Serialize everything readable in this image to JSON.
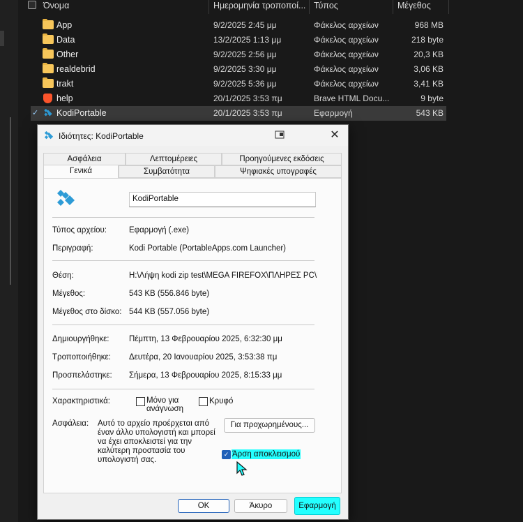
{
  "explorer": {
    "columns": {
      "name": "Όνομα",
      "date": "Ημερομηνία τροποποί...",
      "type": "Τύπος",
      "size": "Μέγεθος"
    },
    "rows": [
      {
        "name": "App",
        "date": "9/2/2025 2:45 μμ",
        "type": "Φάκελος αρχείων",
        "size": "968 MB",
        "icon": "folder-icon"
      },
      {
        "name": "Data",
        "date": "13/2/2025 1:13 μμ",
        "type": "Φάκελος αρχείων",
        "size": "218 byte",
        "icon": "folder-icon"
      },
      {
        "name": "Other",
        "date": "9/2/2025 2:56 μμ",
        "type": "Φάκελος αρχείων",
        "size": "20,3 KB",
        "icon": "folder-icon"
      },
      {
        "name": "realdebrid",
        "date": "9/2/2025 3:30 μμ",
        "type": "Φάκελος αρχείων",
        "size": "3,06 KB",
        "icon": "folder-icon"
      },
      {
        "name": "trakt",
        "date": "9/2/2025 5:36 μμ",
        "type": "Φάκελος αρχείων",
        "size": "3,41 KB",
        "icon": "folder-icon"
      },
      {
        "name": "help",
        "date": "20/1/2025 3:53 πμ",
        "type": "Brave HTML Docu...",
        "size": "9 byte",
        "icon": "brave-icon"
      },
      {
        "name": "KodiPortable",
        "date": "20/1/2025 3:53 πμ",
        "type": "Εφαρμογή",
        "size": "543 KB",
        "icon": "kodi-icon"
      }
    ]
  },
  "dialog": {
    "title": "Ιδιότητες: KodiPortable",
    "tabs_row1": [
      "Ασφάλεια",
      "Λεπτομέρειες",
      "Προηγούμενες εκδόσεις"
    ],
    "tabs_row2": [
      "Γενικά",
      "Συμβατότητα",
      "Ψηφιακές υπογραφές"
    ],
    "file_name": "KodiPortable",
    "fields": {
      "type_label": "Τύπος αρχείου:",
      "type_value": "Εφαρμογή (.exe)",
      "desc_label": "Περιγραφή:",
      "desc_value": "Kodi Portable (PortableApps.com Launcher)",
      "location_label": "Θέση:",
      "location_value": "H:\\Λήψη kodi zip test\\MEGA FIREFOX\\ΠΛΗΡΕΣ PC\\Koc",
      "size_label": "Μέγεθος:",
      "size_value": "543 KB (556.846 byte)",
      "disk_label": "Μέγεθος στο δίσκο:",
      "disk_value": "544 KB (557.056 byte)",
      "created_label": "Δημιουργήθηκε:",
      "created_value": "Πέμπτη, 13 Φεβρουαρίου 2025, 6:32:30 μμ",
      "modified_label": "Τροποποιήθηκε:",
      "modified_value": "Δευτέρα, 20 Ιανουαρίου 2025, 3:53:38 πμ",
      "accessed_label": "Προσπελάστηκε:",
      "accessed_value": "Σήμερα, 13 Φεβρουαρίου 2025, 8:15:33 μμ",
      "attributes_label": "Χαρακτηριστικά:",
      "readonly_line1": "Μόνο για",
      "readonly_line2": "ανάγνωση",
      "hidden_label": "Κρυφό",
      "security_label": "Ασφάλεια:",
      "security_text": "Αυτό το αρχείο προέρχεται από έναν άλλο υπολογιστή και μπορεί να έχει αποκλειστεί για την καλύτερη προστασία του υπολογιστή σας.",
      "advanced_button": "Για προχωρημένους...",
      "unblock_label": "Άρση αποκλεισμού",
      "unblock_checked": true
    },
    "buttons": {
      "ok": "OK",
      "cancel": "Άκυρο",
      "apply": "Εφαρμογή"
    },
    "colors": {
      "highlight": "#24ffff",
      "checkbox_accent": "#1f5fb8",
      "kodi_blue": "#2d9bd6"
    }
  }
}
